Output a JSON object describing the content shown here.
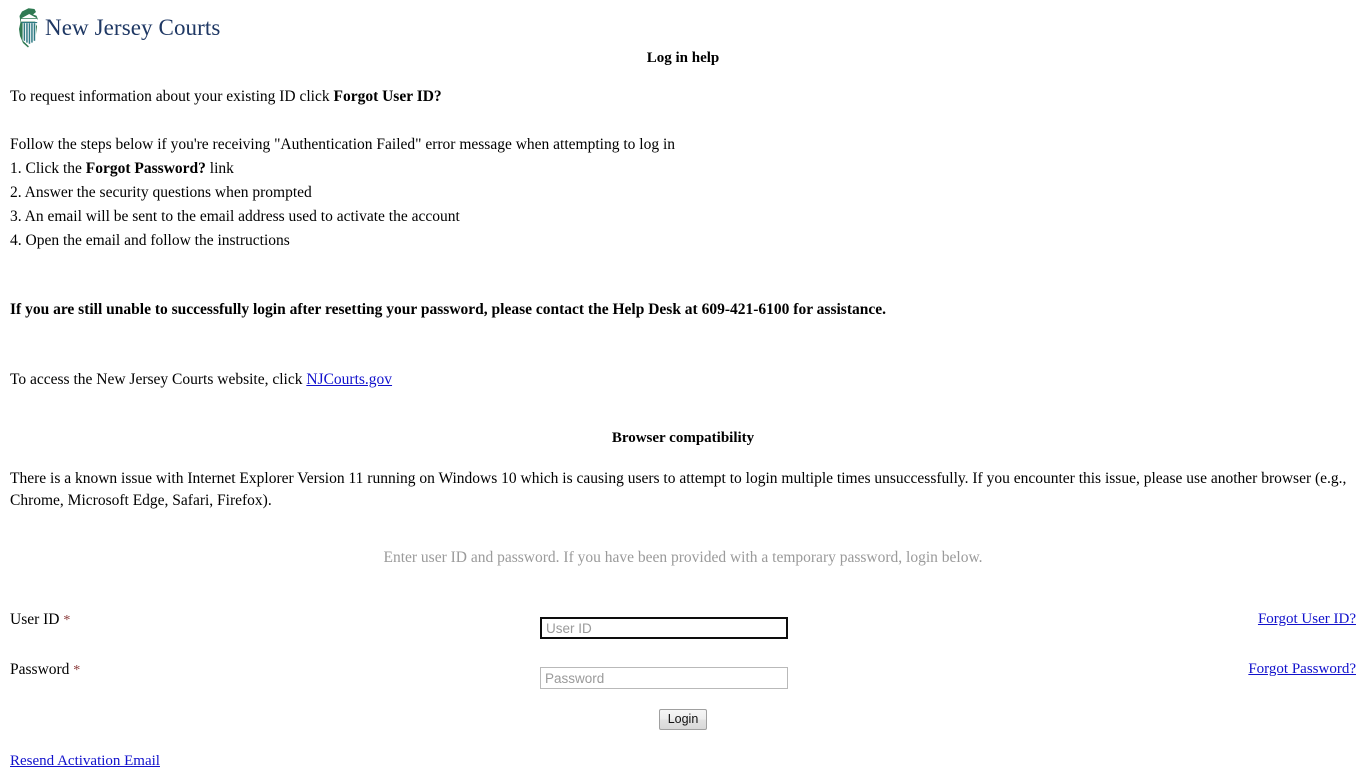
{
  "brand": {
    "name": "New Jersey Courts",
    "logo_icon": "nj-state-outline-column-icon",
    "logo_green": "#2f7a52",
    "logo_teal": "#2f7a83",
    "text_color": "#1f3864"
  },
  "headings": {
    "login_help": "Log in help",
    "browser_compatibility": "Browser compatibility"
  },
  "help": {
    "request_info_prefix": "To request information about your existing ID click ",
    "request_info_bold": "Forgot User ID?",
    "follow_steps": "Follow the steps below if you're receiving \"Authentication Failed\" error message when attempting to log in",
    "step1_prefix": "1. Click the ",
    "step1_bold": "Forgot Password?",
    "step1_suffix": " link",
    "step2": "2. Answer the security questions when prompted",
    "step3": "3. An email will be sent to the email address used to activate the account",
    "step4": "4. Open the email and follow the instructions",
    "helpdesk_notice": "If you are still unable to successfully login after resetting your password, please contact the Help Desk at 609-421-6100 for assistance.",
    "helpdesk_phone": "609-421-6100",
    "website_prefix": "To access the New Jersey Courts website, click ",
    "website_link_text": "NJCourts.gov"
  },
  "browser": {
    "notice": "There is a known issue with Internet Explorer Version 11 running on Windows 10 which is causing users to attempt to login multiple times unsuccessfully. If you encounter this issue, please use another browser (e.g., Chrome, Microsoft Edge, Safari, Firefox)."
  },
  "form": {
    "intro": "Enter user ID and password. If you have been provided with a temporary password, login below.",
    "userid_label": "User ID",
    "password_label": "Password",
    "required_marker": "*",
    "userid_value": "",
    "userid_placeholder": "User ID",
    "password_value": "",
    "password_placeholder": "Password",
    "login_button": "Login",
    "forgot_userid_link": "Forgot User ID?",
    "forgot_password_link": "Forgot Password?",
    "resend_activation_link": "Resend Activation Email",
    "link_color": "#1111cc",
    "required_color": "#8a3a3a",
    "intro_color": "#9a9a9a"
  }
}
